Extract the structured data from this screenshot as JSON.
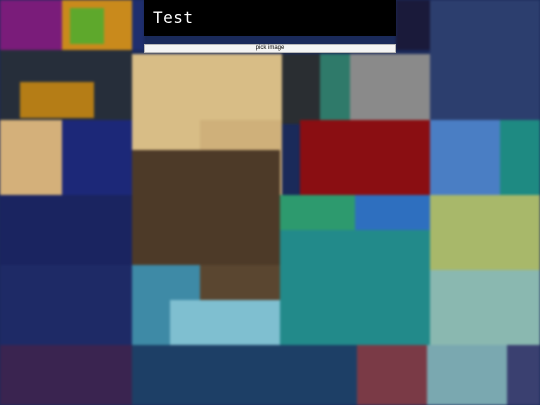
{
  "header": {
    "title": "Test"
  },
  "controls": {
    "pick_image_label": "pick image"
  },
  "colors": {
    "title_bar": "#000000",
    "title_text": "#ffffff",
    "button_bg": "#f4f4f4",
    "button_border": "#b8b8b8"
  }
}
